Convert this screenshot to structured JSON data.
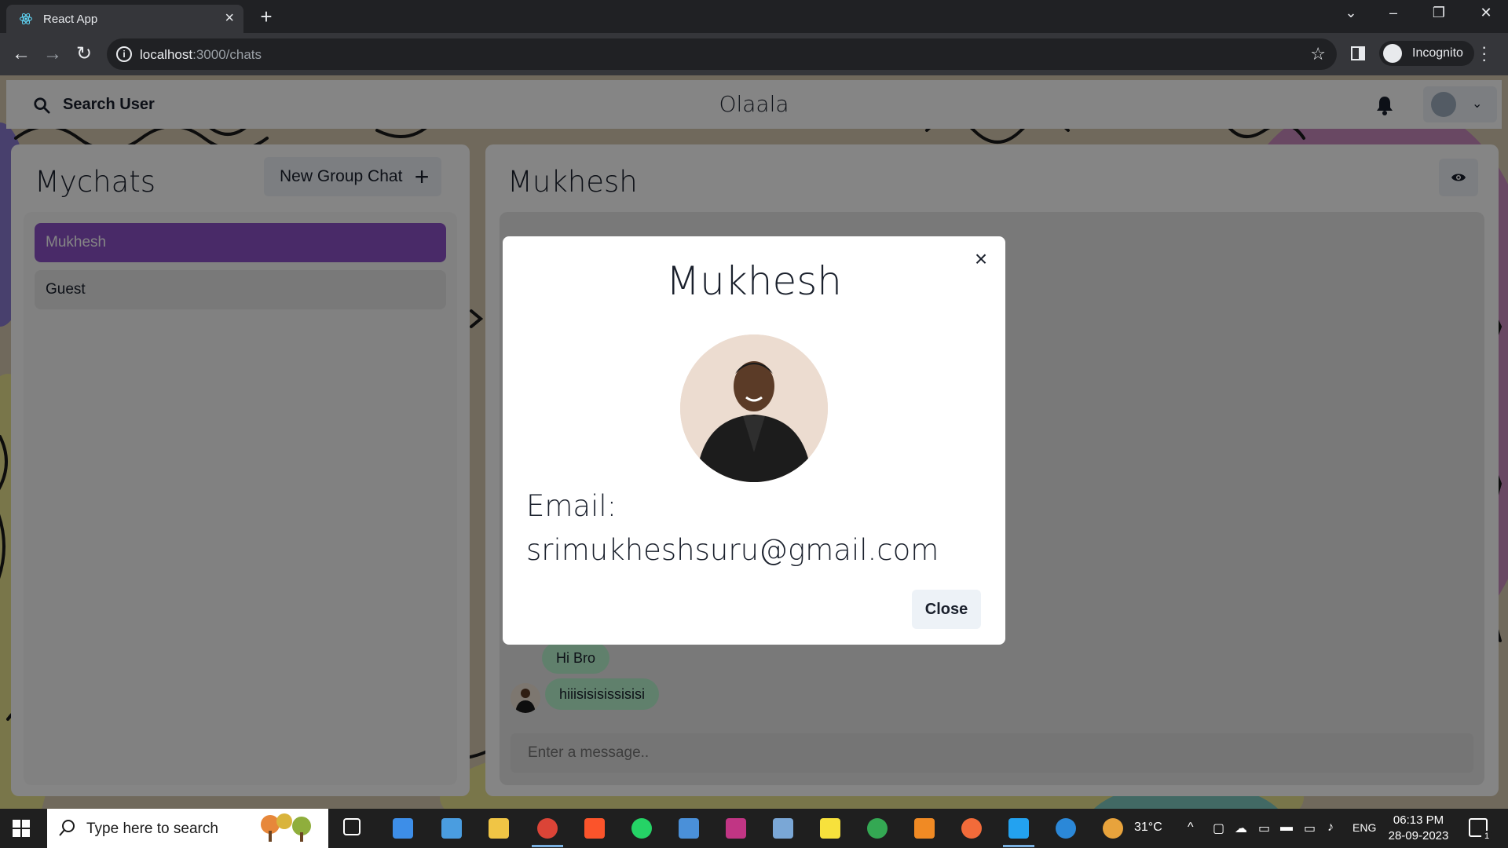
{
  "browser": {
    "tab_title": "React App",
    "url_host": "localhost",
    "url_path": ":3000/chats",
    "profile_label": "Incognito"
  },
  "header": {
    "search_label": "Search User",
    "brand": "Olaala"
  },
  "sidebar": {
    "title": "Mychats",
    "new_group_label": "New Group Chat",
    "chats": [
      {
        "name": "Mukhesh",
        "active": true
      },
      {
        "name": "Guest",
        "active": false
      }
    ]
  },
  "chat": {
    "title": "Mukhesh",
    "messages": [
      {
        "text": "Hi Bro"
      },
      {
        "text": "hiiisisisissisisi"
      }
    ],
    "input_placeholder": "Enter a message.."
  },
  "modal": {
    "title": "Mukhesh",
    "email_label": "Email:",
    "email": "srimukheshsuru@gmail.com",
    "close_label": "Close"
  },
  "taskbar": {
    "search_placeholder": "Type here to search",
    "temperature": "31°C",
    "language": "ENG",
    "time": "06:13 PM",
    "date": "28-09-2023",
    "notification_count": "1"
  },
  "colors": {
    "accent": "#8c52c8",
    "message_bubble": "#b9f5d0"
  }
}
